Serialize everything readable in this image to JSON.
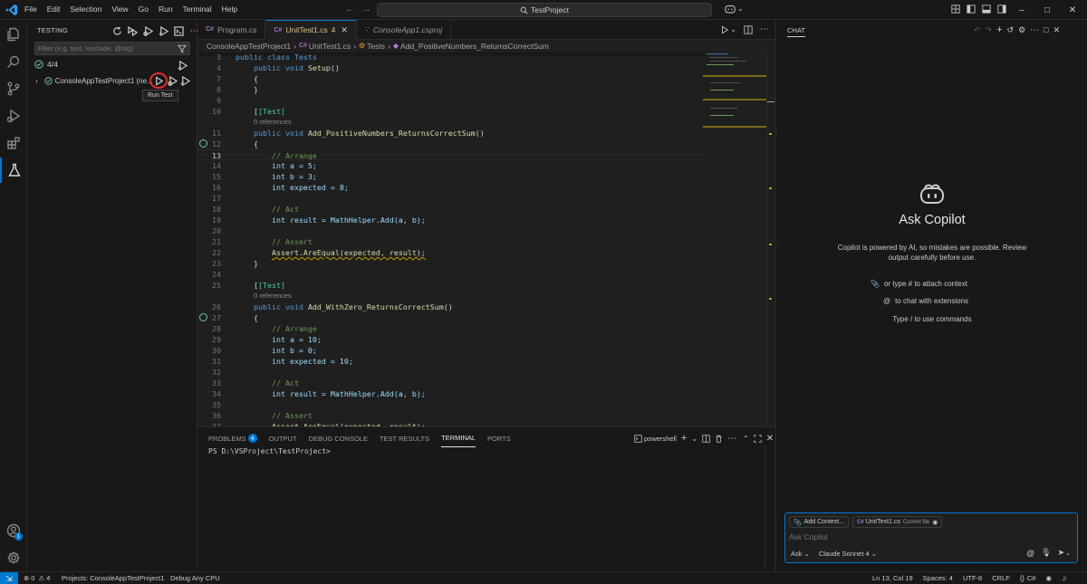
{
  "titlebar": {
    "menu": [
      "File",
      "Edit",
      "Selection",
      "View",
      "Go",
      "Run",
      "Terminal",
      "Help"
    ],
    "search": "TestProject"
  },
  "testing": {
    "title": "TESTING",
    "filter_placeholder": "Filter (e.g. text, !exclude, @tag)",
    "summary": "4/4",
    "project_item": "ConsoleAppTestProject1 (ne...",
    "tooltip": "Run Test"
  },
  "tabs": [
    {
      "label": "Program.cs",
      "icon": "csharp-icon"
    },
    {
      "label": "UnitTest1.cs",
      "badge": "4",
      "icon": "csharp-icon"
    },
    {
      "label": "ConsoleApp1.csproj",
      "icon": "rss-icon"
    }
  ],
  "breadcrumb": [
    "ConsoleAppTestProject1",
    "UnitTest1.cs",
    "Tests",
    "Add_PositiveNumbers_ReturnsCorrectSum"
  ],
  "code": {
    "l3": "public class Tests",
    "l4_kw": "public void",
    "l4_fn": "Setup",
    "refs": "0 references",
    "test_attr": "[Test]",
    "l11_fn": "Add_PositiveNumbers_ReturnsCorrectSum",
    "l26_fn": "Add_WithZero_ReturnsCorrectSum",
    "arrange": "// Arrange",
    "act": "// Act",
    "assert": "// Assert",
    "a5": "int a = 5;",
    "b3": "int b = 3;",
    "exp8": "int expected = 8;",
    "a10": "int a = 10;",
    "b0": "int b = 0;",
    "exp10": "int expected = 10;",
    "result": "int result = MathHelper.Add(a, b);",
    "assert_call": "Assert.AreEqual(expected, result);"
  },
  "panel": {
    "tabs": [
      "PROBLEMS",
      "OUTPUT",
      "DEBUG CONSOLE",
      "TEST RESULTS",
      "TERMINAL",
      "PORTS"
    ],
    "problems_badge": "4",
    "shell": "powershell",
    "prompt": "PS D:\\VSProject\\TestProject>"
  },
  "chat": {
    "header": "CHAT",
    "title": "Ask Copilot",
    "desc1": "Copilot is powered by AI, so mistakes are possible. Review",
    "desc2": "output carefully before use.",
    "hint1": "or type # to attach context",
    "hint2": "to chat with extensions",
    "hint3": "Type / to use commands",
    "add_context": "Add Context...",
    "file_chip": "UnitTest1.cs",
    "file_chip_note": "Current file",
    "input_placeholder": "Ask Copilot",
    "mode": "Ask",
    "model": "Claude Sonnet 4"
  },
  "status": {
    "errors": "0",
    "warnings": "4",
    "projects": "Projects: ConsoleAppTestProject1",
    "debug": "Debug Any CPU",
    "position": "Ln 13, Col 19",
    "spaces": "Spaces: 4",
    "encoding": "UTF-8",
    "eol": "CRLF",
    "language": "C#"
  },
  "colors": {
    "accent": "#0078d4",
    "pass": "#73c991",
    "warn": "#c4a000"
  }
}
